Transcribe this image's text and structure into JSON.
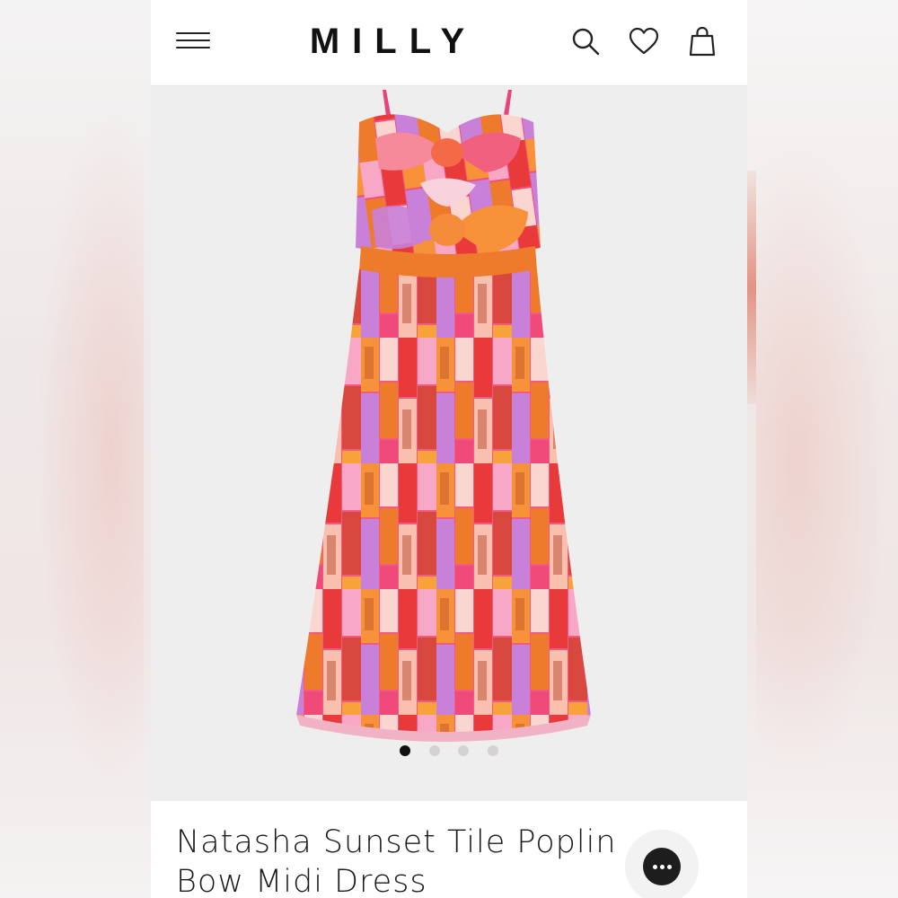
{
  "header": {
    "logo": "MILLY",
    "icons": [
      "menu-icon",
      "search-icon",
      "heart-icon",
      "shopping-bag-icon"
    ]
  },
  "gallery": {
    "image_count": 4,
    "active_index": 0,
    "palette": [
      "#f0437a",
      "#f7923a",
      "#e83a3a",
      "#f8a7c6",
      "#c980d8",
      "#ee7a2c",
      "#fbd6d0",
      "#d8483e"
    ]
  },
  "product": {
    "title_line1": "Natasha Sunset Tile Poplin",
    "title_line2": "Bow Midi Dress"
  },
  "chat": {
    "icon": "chat-icon"
  }
}
